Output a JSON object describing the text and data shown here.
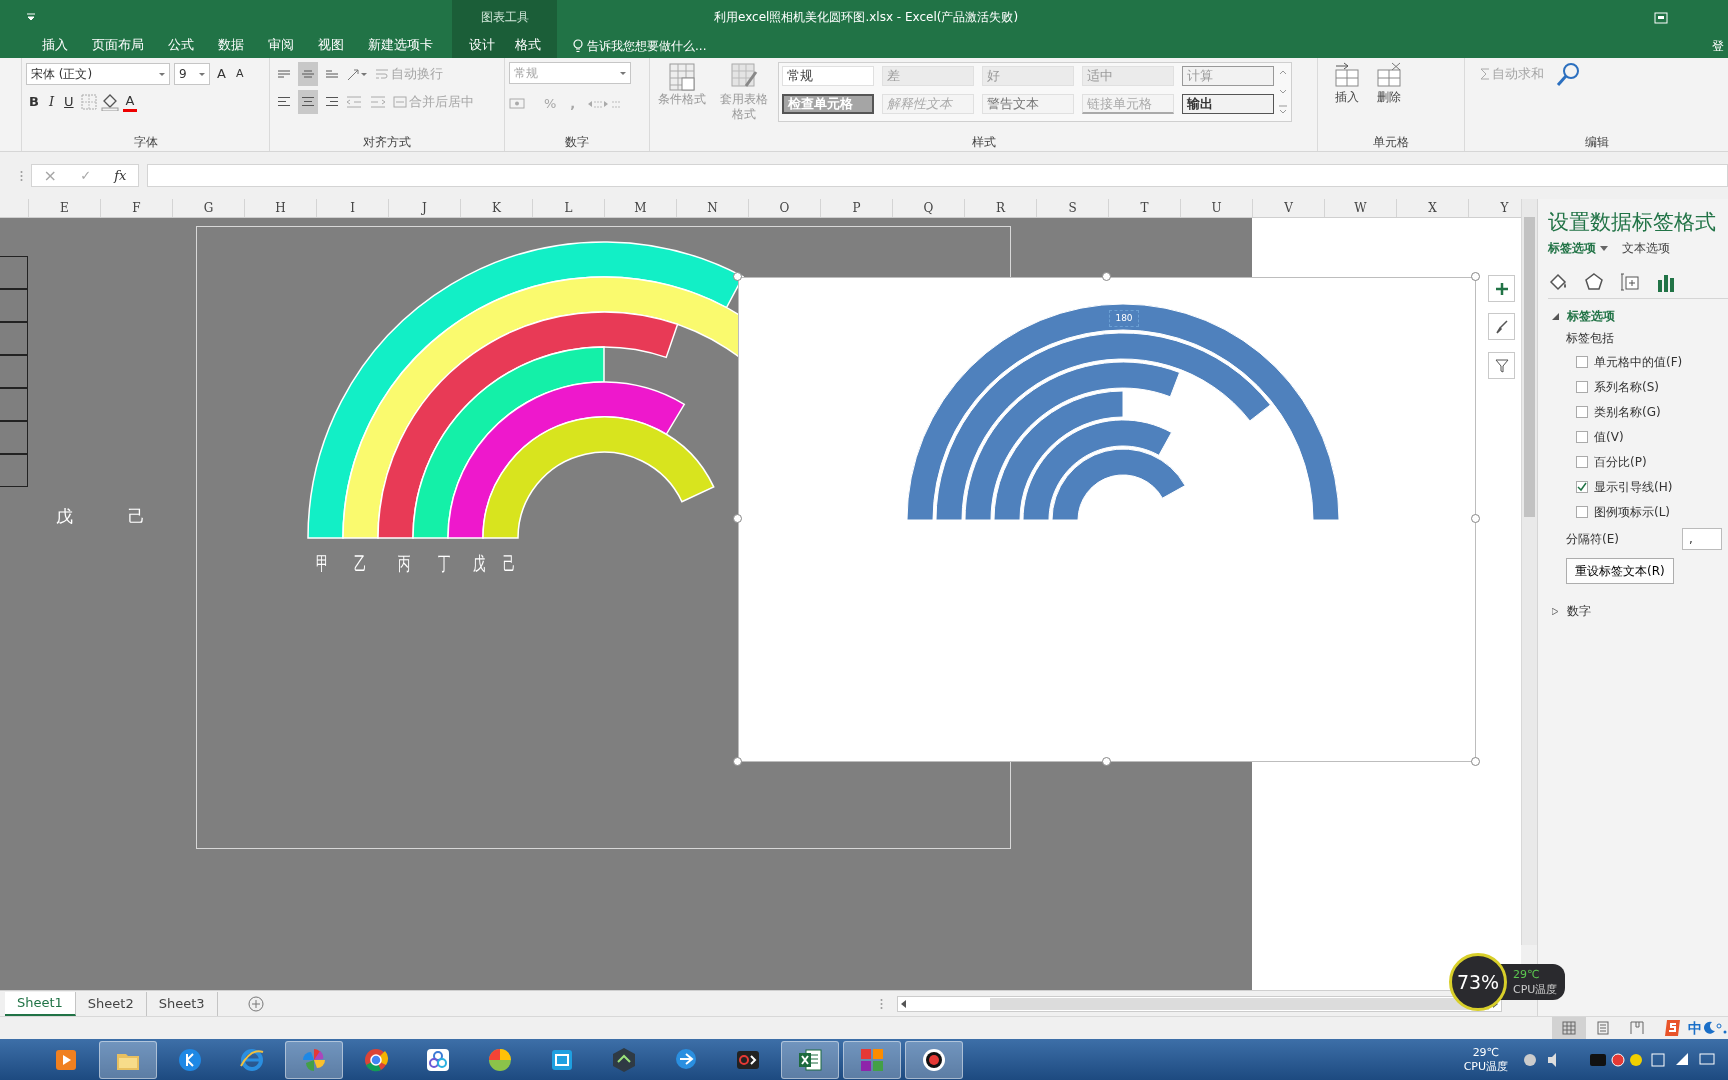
{
  "title_bar": {
    "title": "利用excel照相机美化圆环图.xlsx - Excel(产品激活失败)",
    "context_label": "图表工具"
  },
  "menu_tabs": [
    {
      "label": "插入",
      "kind": "normal",
      "selected": false
    },
    {
      "label": "页面布局",
      "kind": "normal",
      "selected": false
    },
    {
      "label": "公式",
      "kind": "normal",
      "selected": false
    },
    {
      "label": "数据",
      "kind": "normal",
      "selected": false
    },
    {
      "label": "审阅",
      "kind": "normal",
      "selected": false
    },
    {
      "label": "视图",
      "kind": "normal",
      "selected": false
    },
    {
      "label": "新建选项卡",
      "kind": "normal",
      "selected": false
    },
    {
      "label": "设计",
      "kind": "context",
      "selected": false
    },
    {
      "label": "格式",
      "kind": "context",
      "selected": false
    }
  ],
  "tell_me": "告诉我您想要做什么...",
  "sign_in": "登",
  "ribbon": {
    "font": {
      "label": "字体",
      "font_name": "宋体 (正文)",
      "font_size": "9",
      "grow": "A",
      "shrink": "A",
      "bold": "B",
      "italic": "I",
      "underline": "U",
      "font_color": "A"
    },
    "alignment": {
      "label": "对齐方式",
      "wrap_text": "自动换行",
      "merge_center": "合并后居中",
      "vertical": [
        {
          "kind": "top",
          "selected": false
        },
        {
          "kind": "middle",
          "selected": true
        },
        {
          "kind": "bottom",
          "selected": false
        }
      ],
      "horizontal": [
        {
          "kind": "left",
          "selected": false
        },
        {
          "kind": "center",
          "selected": true
        },
        {
          "kind": "right",
          "selected": false
        }
      ]
    },
    "number": {
      "label": "数字",
      "format": "常规",
      "percent": "%",
      "comma": ","
    },
    "styles": {
      "label": "样式",
      "conditional": "条件格式",
      "table": "套用表格格式",
      "cells": [
        {
          "label": "常规",
          "kind": "normal"
        },
        {
          "label": "差",
          "kind": "bad"
        },
        {
          "label": "好",
          "kind": "good"
        },
        {
          "label": "适中",
          "kind": "neutral"
        },
        {
          "label": "计算",
          "kind": "calc"
        },
        {
          "label": "检查单元格",
          "kind": "check"
        },
        {
          "label": "解释性文本",
          "kind": "explanatory"
        },
        {
          "label": "警告文本",
          "kind": "warning"
        },
        {
          "label": "链接单元格",
          "kind": "linked"
        },
        {
          "label": "输出",
          "kind": "output"
        }
      ]
    },
    "cells": {
      "label": "单元格",
      "insert": "插入",
      "delete": "删除"
    },
    "editing": {
      "label": "编辑",
      "autosum": "自动求和"
    }
  },
  "formula_bar": {
    "cancel": "×",
    "enter": "✓",
    "function": "fx"
  },
  "columns": [
    "E",
    "F",
    "G",
    "H",
    "I",
    "J",
    "K",
    "L",
    "M",
    "N",
    "O",
    "P",
    "Q",
    "R",
    "S",
    "T",
    "U",
    "V",
    "W",
    "X",
    "Y"
  ],
  "sheet_cells": [
    {
      "text": "戊"
    },
    {
      "text": "己"
    }
  ],
  "rainbow_chart": {
    "category_labels": [
      "甲",
      "乙",
      "丙",
      "丁",
      "戊",
      "己"
    ]
  },
  "ring_chart": {
    "data_label": "180"
  },
  "format_pane": {
    "title": "设置数据标签格式",
    "tabs": [
      {
        "label": "标签选项",
        "selected": true
      },
      {
        "label": "文本选项",
        "selected": false
      }
    ],
    "icon_tabs": [
      {
        "kind": "fill",
        "selected": false
      },
      {
        "kind": "effects",
        "selected": false
      },
      {
        "kind": "size",
        "selected": false
      },
      {
        "kind": "options",
        "selected": true
      }
    ],
    "section": {
      "label": "标签选项",
      "expanded": true
    },
    "includes_label": "标签包括",
    "checkboxes": [
      {
        "label": "单元格中的值(F)",
        "checked": false
      },
      {
        "label": "系列名称(S)",
        "checked": false
      },
      {
        "label": "类别名称(G)",
        "checked": false
      },
      {
        "label": "值(V)",
        "checked": false
      },
      {
        "label": "百分比(P)",
        "checked": false
      },
      {
        "label": "显示引导线(H)",
        "checked": true
      },
      {
        "label": "图例项标示(L)",
        "checked": false
      }
    ],
    "separator_label": "分隔符(E)",
    "separator_value": ",",
    "reset_button": "重设标签文本(R)",
    "number_section": {
      "label": "数字",
      "expanded": false
    }
  },
  "sheet_tabs": [
    {
      "label": "Sheet1",
      "selected": true
    },
    {
      "label": "Sheet2",
      "selected": false
    },
    {
      "label": "Sheet3",
      "selected": false
    }
  ],
  "status_bar": {
    "views": [
      {
        "kind": "normal",
        "selected": true
      },
      {
        "kind": "layout",
        "selected": false
      },
      {
        "kind": "pagebreak",
        "selected": false
      }
    ],
    "ime": "中"
  },
  "cpu_widget": {
    "usage": "73%",
    "temperature": "29℃",
    "label": "CPU温度"
  },
  "taskbar": {
    "buttons": [
      {
        "kind": "media",
        "open": false
      },
      {
        "kind": "folder",
        "open": true
      },
      {
        "kind": "k",
        "open": false
      },
      {
        "kind": "ie",
        "open": false
      },
      {
        "kind": "pinwheel",
        "open": true
      },
      {
        "kind": "chrome",
        "open": false
      },
      {
        "kind": "flower",
        "open": false
      },
      {
        "kind": "ball",
        "open": false
      },
      {
        "kind": "screen",
        "open": false
      },
      {
        "kind": "hexagon",
        "open": false
      },
      {
        "kind": "bubble",
        "open": false
      },
      {
        "kind": "dark",
        "open": false
      },
      {
        "kind": "excel",
        "open": true
      },
      {
        "kind": "tiles",
        "open": true
      },
      {
        "kind": "record",
        "open": true
      }
    ],
    "temperature": "29℃",
    "temperature_label": "CPU温度"
  }
}
